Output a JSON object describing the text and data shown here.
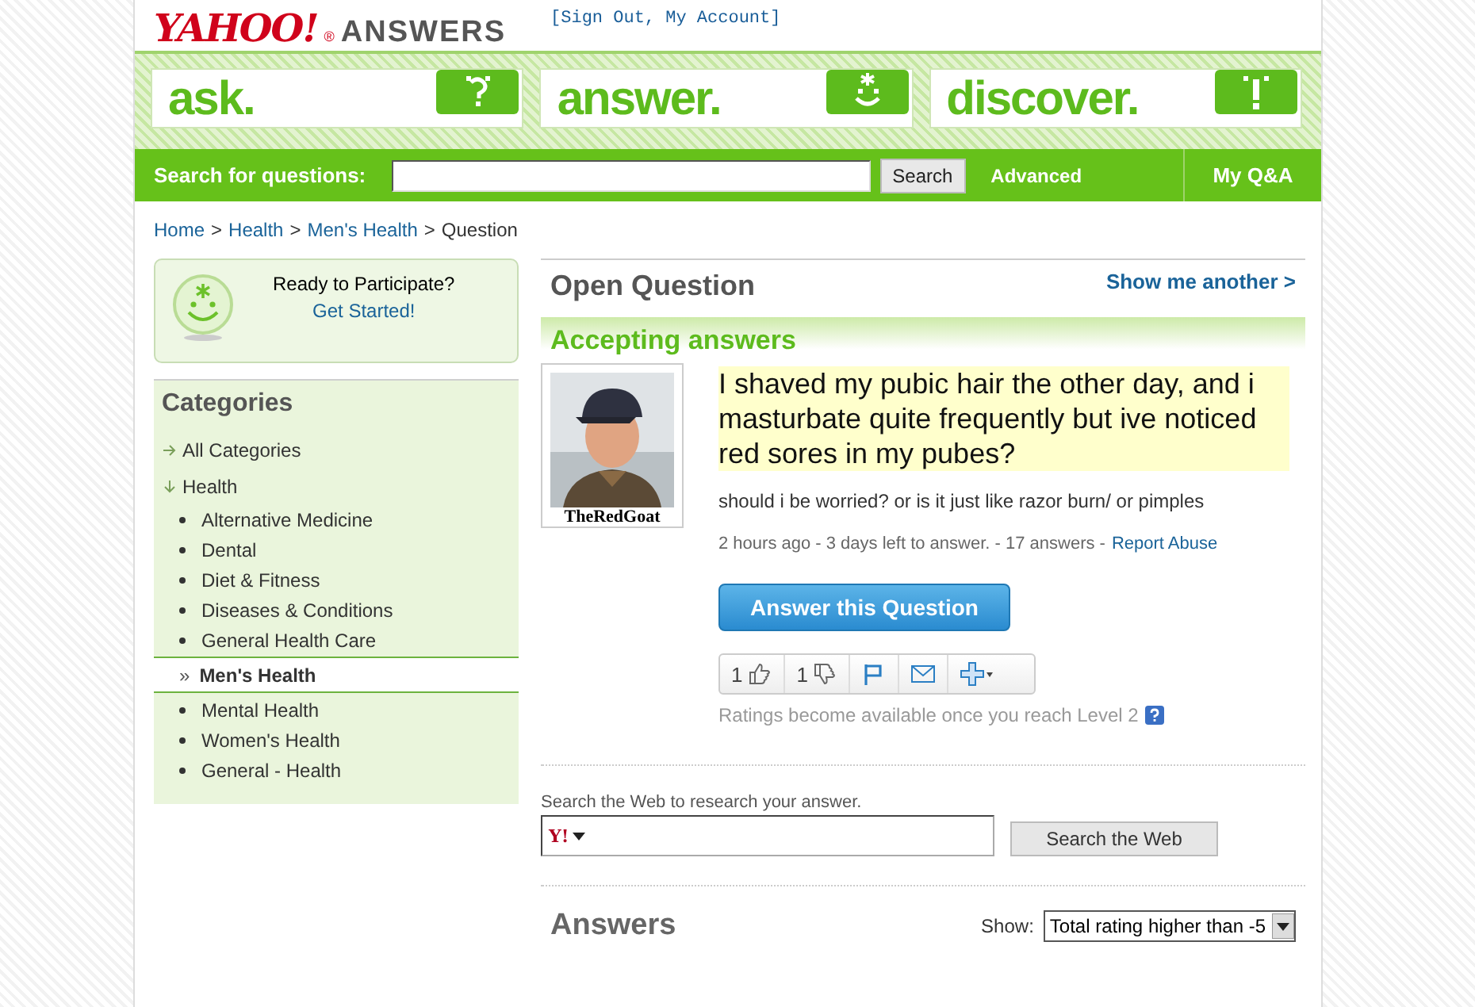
{
  "header": {
    "logo": "YAHOO!",
    "logo_mark": "®",
    "product": "ANSWERS",
    "account_links": "[Sign Out, My Account]"
  },
  "tiles": [
    {
      "label": "ask.",
      "kind": "ask"
    },
    {
      "label": "answer.",
      "kind": "answer"
    },
    {
      "label": "discover.",
      "kind": "discover"
    }
  ],
  "search_bar": {
    "label": "Search for questions:",
    "button": "Search",
    "advanced": "Advanced",
    "my_qa": "My Q&A"
  },
  "breadcrumb": [
    {
      "label": "Home",
      "link": true,
      "separator": ">"
    },
    {
      "label": "Health",
      "link": true,
      "separator": ">"
    },
    {
      "label": "Men's Health",
      "link": true,
      "separator": ">"
    },
    {
      "label": "Question",
      "link": false
    }
  ],
  "participate": {
    "prompt": "Ready to Participate?",
    "link": "Get Started!"
  },
  "categories": {
    "title": "Categories",
    "items": [
      {
        "label": "All Categories",
        "expanded": false
      },
      {
        "label": "Health",
        "expanded": true,
        "children": [
          {
            "label": "Alternative Medicine",
            "selected": false
          },
          {
            "label": "Dental",
            "selected": false
          },
          {
            "label": "Diet & Fitness",
            "selected": false
          },
          {
            "label": "Diseases & Conditions",
            "selected": false
          },
          {
            "label": "General Health Care",
            "selected": false
          },
          {
            "label": "Men's Health",
            "selected": true,
            "marker": "»"
          },
          {
            "label": "Mental Health",
            "selected": false
          },
          {
            "label": "Women's Health",
            "selected": false
          },
          {
            "label": "General - Health",
            "selected": false
          }
        ]
      }
    ]
  },
  "question": {
    "status": "Open Question",
    "show_another": "Show me another >",
    "accepting": "Accepting answers",
    "user": "TheRedGoat",
    "title": "I shaved my pubic hair the other day, and i masturbate quite frequently but ive noticed red sores in my pubes?",
    "body": "should i be worried? or is it just like razor burn/ or pimples",
    "meta": "2 hours ago - 3 days left to answer. - 17 answers -",
    "report": "Report Abuse",
    "answer_button": "Answer this Question",
    "thumbs_up": "1",
    "thumbs_down": "1",
    "ratings_note": "Ratings become available once you reach Level 2"
  },
  "web_search": {
    "label": "Search the Web to research your answer.",
    "engine": "Y!",
    "button": "Search the Web"
  },
  "answers": {
    "title": "Answers",
    "show_label": "Show:",
    "filter": "Total rating higher than -5"
  }
}
